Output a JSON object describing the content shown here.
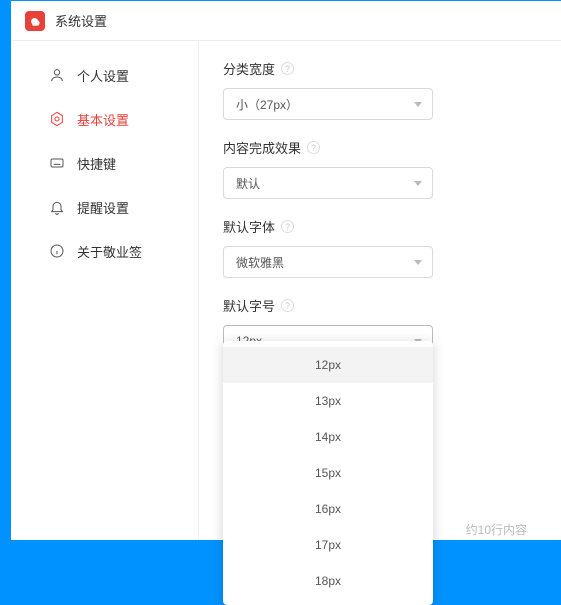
{
  "window": {
    "title": "系统设置"
  },
  "sidebar": {
    "items": [
      {
        "label": "个人设置"
      },
      {
        "label": "基本设置"
      },
      {
        "label": "快捷键"
      },
      {
        "label": "提醒设置"
      },
      {
        "label": "关于敬业签"
      }
    ]
  },
  "fields": {
    "category_width": {
      "label": "分类宽度",
      "value": "小（27px）"
    },
    "completion_effect": {
      "label": "内容完成效果",
      "value": "默认"
    },
    "default_font": {
      "label": "默认字体",
      "value": "微软雅黑"
    },
    "default_size": {
      "label": "默认字号",
      "value": "12px",
      "options": [
        "12px",
        "13px",
        "14px",
        "15px",
        "16px",
        "17px",
        "18px"
      ]
    }
  },
  "hint": "约10行内容",
  "colors": {
    "accent": "#e8413a"
  }
}
